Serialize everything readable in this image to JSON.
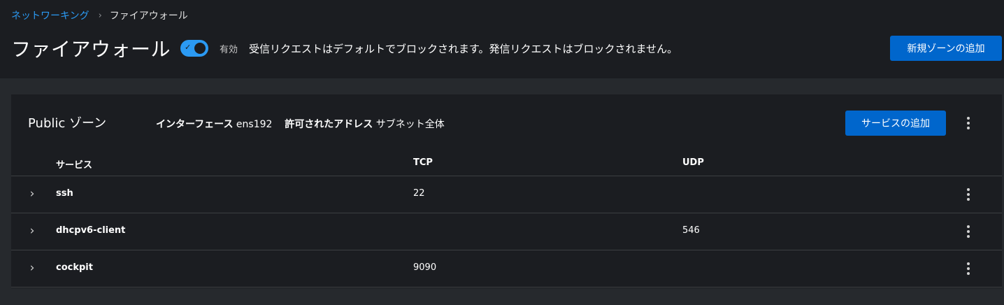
{
  "breadcrumb": {
    "parent": "ネットワーキング",
    "separator": "›",
    "current": "ファイアウォール"
  },
  "header": {
    "title": "ファイアウォール",
    "toggle_state": "on",
    "toggle_check_icon": "✓",
    "toggle_label": "有効",
    "description": "受信リクエストはデフォルトでブロックされます。発信リクエストはブロックされません。",
    "add_zone_label": "新規ゾーンの追加"
  },
  "zone": {
    "title": "Public ゾーン",
    "interface_label": "インターフェース",
    "interface_value": "ens192",
    "allowed_label": "許可されたアドレス",
    "allowed_value": "サブネット全体",
    "add_service_label": "サービスの追加",
    "menu_icon": "kebab-icon"
  },
  "table": {
    "columns": {
      "service": "サービス",
      "tcp": "TCP",
      "udp": "UDP"
    },
    "expand_icon": "›",
    "rows": [
      {
        "service": "ssh",
        "tcp": "22",
        "udp": ""
      },
      {
        "service": "dhcpv6-client",
        "tcp": "",
        "udp": "546"
      },
      {
        "service": "cockpit",
        "tcp": "9090",
        "udp": ""
      }
    ]
  },
  "colors": {
    "accent": "#2b9af3",
    "primary_button": "#0066cc",
    "background": "#26292d",
    "surface": "#1b1d21"
  }
}
